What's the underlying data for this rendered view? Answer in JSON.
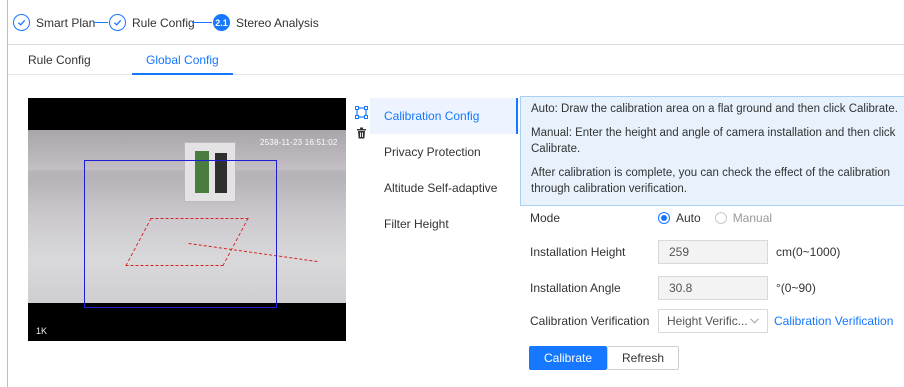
{
  "steps": [
    {
      "label": "Smart Plan",
      "state": "done",
      "icon": "check-icon"
    },
    {
      "label": "Rule Config",
      "state": "done",
      "icon": "check-icon"
    },
    {
      "label": "Stereo Analysis",
      "state": "active",
      "number": "2.1"
    }
  ],
  "tabs": [
    {
      "label": "Rule Config",
      "active": false
    },
    {
      "label": "Global Config",
      "active": true
    }
  ],
  "video": {
    "timestamp": "2538-11-23 16:51:02",
    "watermark": "1K"
  },
  "tools": [
    "draw-rectangle-icon",
    "trash-icon"
  ],
  "menu": [
    {
      "label": "Calibration Config",
      "active": true
    },
    {
      "label": "Privacy Protection",
      "active": false
    },
    {
      "label": "Altitude Self-adaptive",
      "active": false
    },
    {
      "label": "Filter Height",
      "active": false
    }
  ],
  "info": {
    "auto": "Auto: Draw the calibration area on a flat ground and then click Calibrate.",
    "manual": "Manual: Enter the height and angle of camera installation and then click Calibrate.",
    "after": "After calibration is complete, you can check the effect of the calibration through calibration verification."
  },
  "form": {
    "mode_label": "Mode",
    "mode_options": [
      "Auto",
      "Manual"
    ],
    "mode_selected": "Auto",
    "height_label": "Installation Height",
    "height_value": "259",
    "height_unit": "cm(0~1000)",
    "angle_label": "Installation Angle",
    "angle_value": "30.8",
    "angle_unit": "°(0~90)",
    "verify_label": "Calibration Verification",
    "verify_selected": "Height Verific...",
    "verify_link": "Calibration Verification"
  },
  "buttons": {
    "calibrate": "Calibrate",
    "refresh": "Refresh"
  },
  "colors": {
    "accent": "#1677ff",
    "calibration_box": "#1d1dd6",
    "info_bg": "#e7f2fd"
  }
}
